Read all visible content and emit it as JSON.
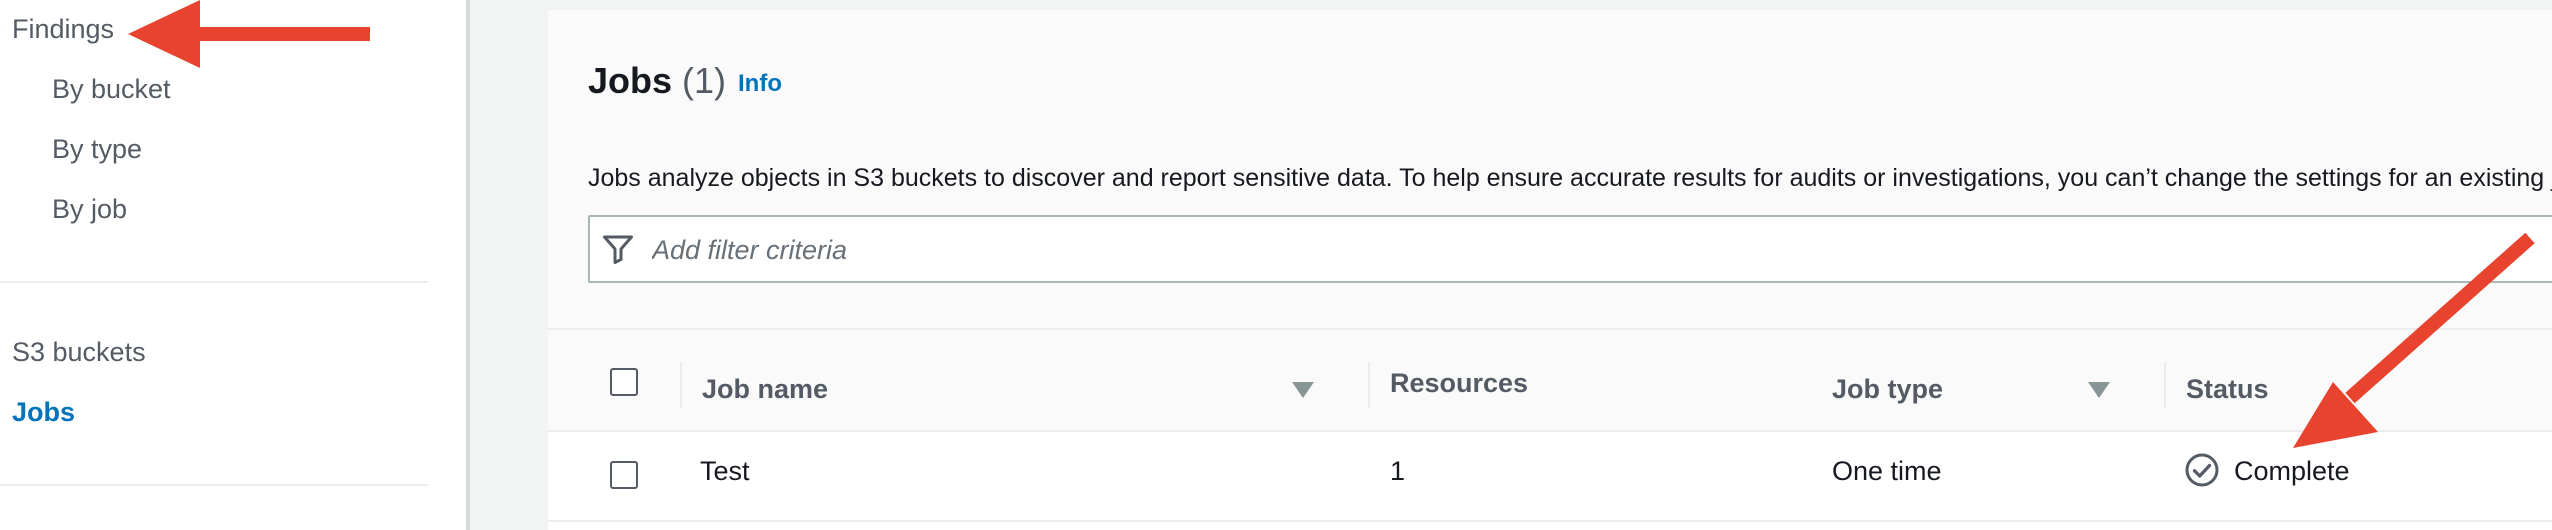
{
  "sidebar": {
    "items": [
      {
        "label": "Findings"
      },
      {
        "label": "By bucket"
      },
      {
        "label": "By type"
      },
      {
        "label": "By job"
      },
      {
        "label": "S3 buckets"
      },
      {
        "label": "Jobs"
      }
    ]
  },
  "jobs_panel": {
    "title": "Jobs",
    "count": "(1)",
    "info_label": "Info",
    "description": "Jobs analyze objects in S3 buckets to discover and report sensitive data. To help ensure accurate results for audits or investigations, you can’t change the settings for an existing job.",
    "filter_placeholder": "Add filter criteria"
  },
  "table": {
    "columns": [
      "Job name",
      "Resources",
      "Job type",
      "Status"
    ],
    "rows": [
      {
        "job_name": "Test",
        "resources": "1",
        "job_type": "One time",
        "status": "Complete"
      }
    ]
  },
  "colors": {
    "accent": "#0073bb",
    "annotation_arrow": "#e8432e",
    "status_icon": "#545b64"
  },
  "icons": [
    "filter-icon",
    "sort-desc-icon",
    "status-check-circle-icon",
    "annotation-arrow"
  ]
}
